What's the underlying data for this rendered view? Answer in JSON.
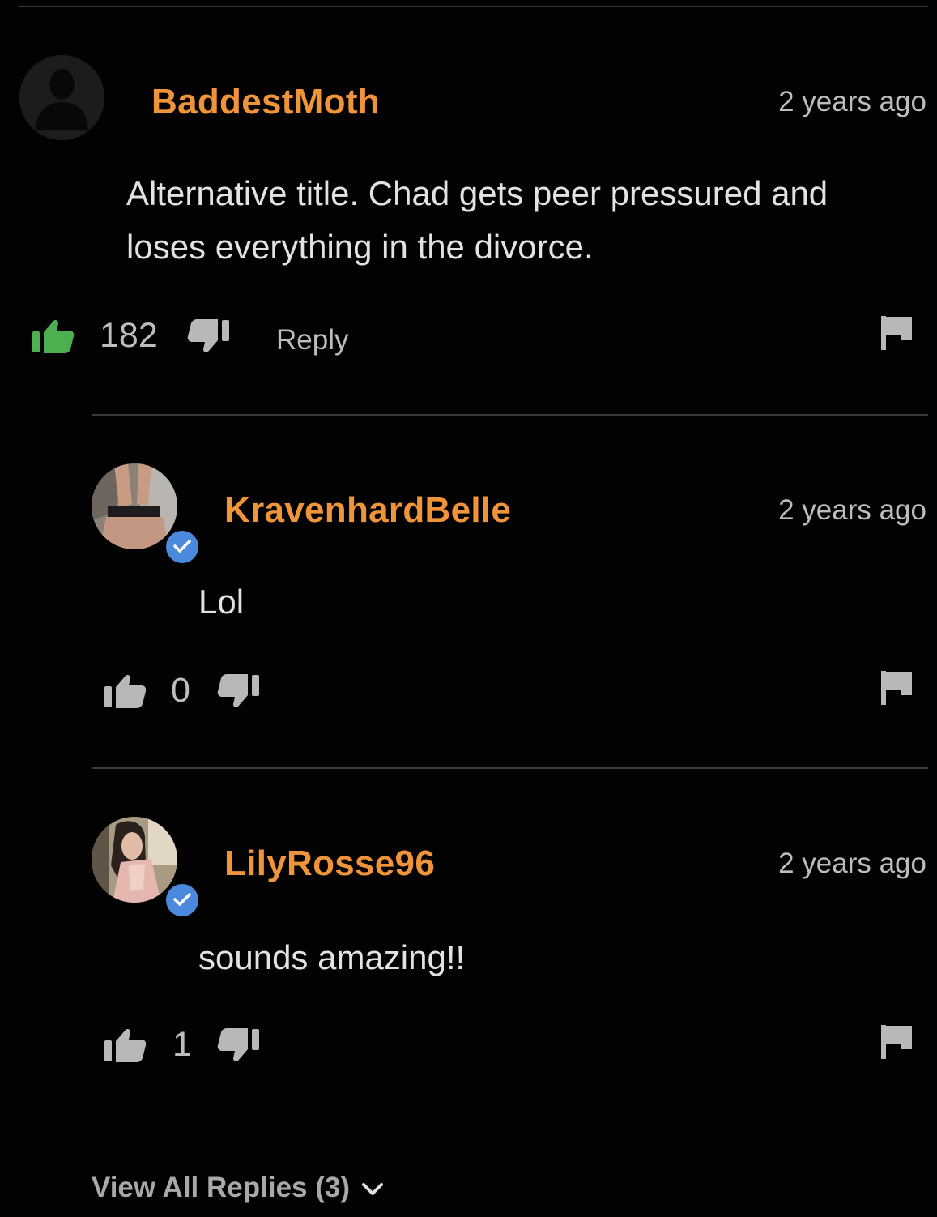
{
  "colors": {
    "background": "#020202",
    "username": "#f0943a",
    "like_active": "#4caf50",
    "icon_gray": "#b8b8b8",
    "verified_badge": "#4a89dc"
  },
  "comments": [
    {
      "username": "BaddestMoth",
      "timestamp": "2 years ago",
      "text_line1": "Alternative title. Chad gets peer pressured and",
      "text_line2": "loses everything in the divorce.",
      "likes": "182",
      "reply_label": "Reply",
      "liked": true,
      "verified": false,
      "avatar": "default-user-silhouette"
    },
    {
      "username": "KravenhardBelle",
      "timestamp": "2 years ago",
      "text": "Lol",
      "likes": "0",
      "liked": false,
      "verified": true,
      "avatar": "user-photo"
    },
    {
      "username": "LilyRosse96",
      "timestamp": "2 years ago",
      "text": "sounds amazing!!",
      "likes": "1",
      "liked": false,
      "verified": true,
      "avatar": "user-photo"
    }
  ],
  "view_all": {
    "label": "View All Replies (3)",
    "icon": "chevron-down-icon"
  }
}
